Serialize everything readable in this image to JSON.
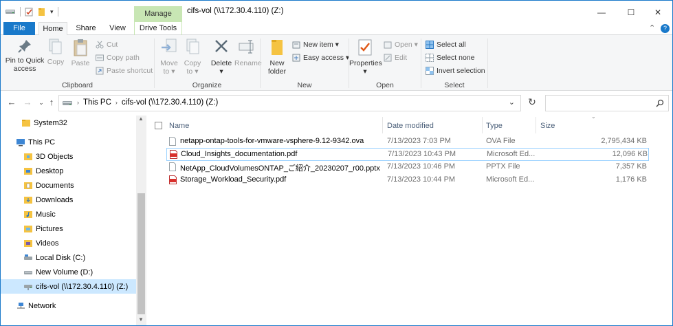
{
  "titlebar": {
    "context_tab": "Manage",
    "title": "cifs-vol (\\\\172.30.4.110) (Z:)",
    "minimize": "—",
    "maximize": "☐",
    "close": "✕"
  },
  "tabs": {
    "file": "File",
    "home": "Home",
    "share": "Share",
    "view": "View",
    "drive_tools": "Drive Tools"
  },
  "ribbon": {
    "clipboard": {
      "pin_line1": "Pin to Quick",
      "pin_line2": "access",
      "copy": "Copy",
      "paste": "Paste",
      "cut": "Cut",
      "copy_path": "Copy path",
      "paste_shortcut": "Paste shortcut",
      "label": "Clipboard"
    },
    "organize": {
      "move_to_line1": "Move",
      "move_to_line2": "to ▾",
      "copy_to_line1": "Copy",
      "copy_to_line2": "to ▾",
      "delete_line1": "Delete",
      "delete_line2": "▾",
      "rename": "Rename",
      "label": "Organize"
    },
    "new": {
      "new_folder_line1": "New",
      "new_folder_line2": "folder",
      "new_item": "New item ▾",
      "easy_access": "Easy access ▾",
      "label": "New"
    },
    "open": {
      "properties_line1": "Properties",
      "properties_line2": "▾",
      "open": "Open ▾",
      "edit": "Edit",
      "label": "Open"
    },
    "select": {
      "select_all": "Select all",
      "select_none": "Select none",
      "invert_selection": "Invert selection",
      "label": "Select"
    }
  },
  "address": {
    "crumb_this_pc": "This PC",
    "crumb_drive": "cifs-vol (\\\\172.30.4.110) (Z:)",
    "search_placeholder": ""
  },
  "nav": {
    "items": [
      {
        "label": "System32",
        "icon": "folder-icon"
      },
      {
        "label": "This PC",
        "icon": "computer-icon"
      },
      {
        "label": "3D Objects",
        "icon": "folder-3d-icon"
      },
      {
        "label": "Desktop",
        "icon": "desktop-folder-icon"
      },
      {
        "label": "Documents",
        "icon": "documents-folder-icon"
      },
      {
        "label": "Downloads",
        "icon": "downloads-folder-icon"
      },
      {
        "label": "Music",
        "icon": "music-folder-icon"
      },
      {
        "label": "Pictures",
        "icon": "pictures-folder-icon"
      },
      {
        "label": "Videos",
        "icon": "videos-folder-icon"
      },
      {
        "label": "Local Disk (C:)",
        "icon": "local-disk-icon"
      },
      {
        "label": "New Volume (D:)",
        "icon": "drive-icon"
      },
      {
        "label": "cifs-vol (\\\\172.30.4.110) (Z:)",
        "icon": "network-drive-icon"
      },
      {
        "label": "Network",
        "icon": "network-icon"
      }
    ]
  },
  "files": {
    "headers": {
      "name": "Name",
      "date": "Date modified",
      "type": "Type",
      "size": "Size"
    },
    "rows": [
      {
        "name": "netapp-ontap-tools-for-vmware-vsphere-9.12-9342.ova",
        "date": "7/13/2023 7:03 PM",
        "type": "OVA File",
        "size": "2,795,434 KB",
        "icon": "generic-file-icon"
      },
      {
        "name": "Cloud_Insights_documentation.pdf",
        "date": "7/13/2023 10:43 PM",
        "type": "Microsoft Ed...",
        "size": "12,096 KB",
        "icon": "pdf-icon"
      },
      {
        "name": "NetApp_CloudVolumesONTAP_ご紹介_20230207_r00.pptx",
        "date": "7/13/2023 10:46 PM",
        "type": "PPTX File",
        "size": "7,357 KB",
        "icon": "generic-file-icon"
      },
      {
        "name": "Storage_Workload_Security.pdf",
        "date": "7/13/2023 10:44 PM",
        "type": "Microsoft Ed...",
        "size": "1,176 KB",
        "icon": "pdf-icon"
      }
    ]
  },
  "colors": {
    "accent": "#1979ca",
    "context_tab": "#c8e6b4",
    "selection": "#cce8ff",
    "hover_border": "#99d1ff",
    "pdf_red": "#d9302c"
  }
}
